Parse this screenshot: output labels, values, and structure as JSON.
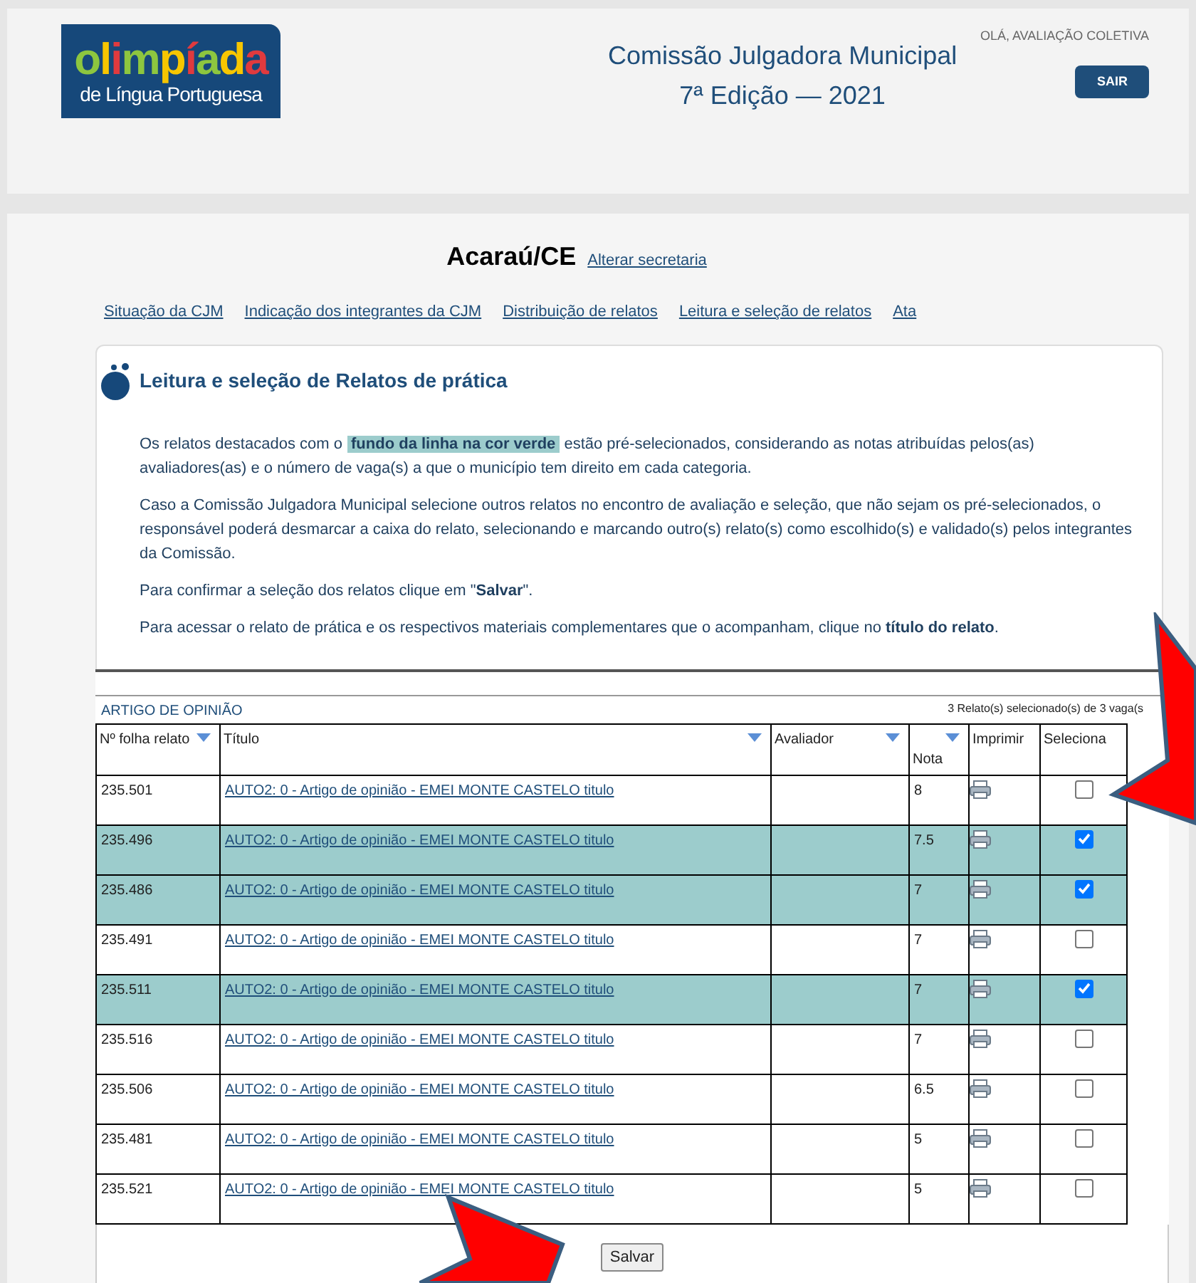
{
  "header": {
    "logo": {
      "word": "olimpíada",
      "subtitle": "de Língua Portuguesa"
    },
    "title_lines": [
      "Comissão Julgadora Municipal",
      "7ª Edição — 2021"
    ],
    "greeting": "OLÁ, AVALIAÇÃO COLETIVA",
    "logout_button": "SAIR"
  },
  "city": {
    "name": "Acaraú/CE",
    "change_link": "Alterar secretaria"
  },
  "nav_links": [
    {
      "label": "Situação da CJM"
    },
    {
      "label": "Indicação dos integrantes da CJM"
    },
    {
      "label": "Distribuição de relatos"
    },
    {
      "label": "Leitura e seleção de relatos"
    },
    {
      "label": "Ata"
    }
  ],
  "section": {
    "title": "Leitura e seleção de Relatos de prática",
    "paragraphs": [
      {
        "before": "Os relatos destacados com o ",
        "highlight": "fundo da linha na cor verde",
        "after": " estão pré-selecionados, considerando as notas atribuídas pelos(as) avaliadores(as) e o número de vaga(s) a que o município tem direito em cada categoria."
      },
      {
        "text": "Caso a Comissão Julgadora Municipal selecione outros relatos no encontro de avaliação e seleção, que não sejam os pré-selecionados, o responsável poderá desmarcar a caixa do relato, selecionando e marcando outro(s) relato(s) como escolhido(s) e validado(s) pelos integrantes da Comissão."
      },
      {
        "text": "Para confirmar a seleção dos relatos clique em \"**Salvar**\"."
      },
      {
        "text": "Para acessar o relato de prática e os respectivos materiais complementares que o acompanham, clique no **título do relato**."
      }
    ]
  },
  "table": {
    "category": "ARTIGO DE OPINIÃO",
    "summary": "3 Relato(s) selecionado(s) de 3 vaga(s",
    "columns": [
      {
        "label": "Nº folha relato",
        "sortable": true
      },
      {
        "label": "Título",
        "sortable": true
      },
      {
        "label": "Avaliador",
        "sortable": true
      },
      {
        "label": "Nota",
        "sortable": true
      },
      {
        "label": "Imprimir",
        "sortable": false
      },
      {
        "label": "Seleciona",
        "sortable": false
      }
    ],
    "rows": [
      {
        "number": "235.501",
        "title": "AUTO2: 0 - Artigo de opinião - EMEI MONTE CASTELO titulo",
        "grade": "8",
        "highlighted": false,
        "checked": false
      },
      {
        "number": "235.496",
        "title": "AUTO2: 0 - Artigo de opinião - EMEI MONTE CASTELO titulo",
        "grade": "7.5",
        "highlighted": true,
        "checked": true
      },
      {
        "number": "235.486",
        "title": "AUTO2: 0 - Artigo de opinião - EMEI MONTE CASTELO titulo",
        "grade": "7",
        "highlighted": true,
        "checked": true
      },
      {
        "number": "235.491",
        "title": "AUTO2: 0 - Artigo de opinião - EMEI MONTE CASTELO titulo",
        "grade": "7",
        "highlighted": false,
        "checked": false
      },
      {
        "number": "235.511",
        "title": "AUTO2: 0 - Artigo de opinião - EMEI MONTE CASTELO titulo",
        "grade": "7",
        "highlighted": true,
        "checked": true
      },
      {
        "number": "235.516",
        "title": "AUTO2: 0 - Artigo de opinião - EMEI MONTE CASTELO titulo",
        "grade": "7",
        "highlighted": false,
        "checked": false
      },
      {
        "number": "235.506",
        "title": "AUTO2: 0 - Artigo de opinião - EMEI MONTE CASTELO titulo",
        "grade": "6.5",
        "highlighted": false,
        "checked": false
      },
      {
        "number": "235.481",
        "title": "AUTO2: 0 - Artigo de opinião - EMEI MONTE CASTELO titulo",
        "grade": "5",
        "highlighted": false,
        "checked": false
      },
      {
        "number": "235.521",
        "title": "AUTO2: 0 - Artigo de opinião - EMEI MONTE CASTELO titulo",
        "grade": "5",
        "highlighted": false,
        "checked": false
      }
    ]
  },
  "save_button": "Salvar"
}
